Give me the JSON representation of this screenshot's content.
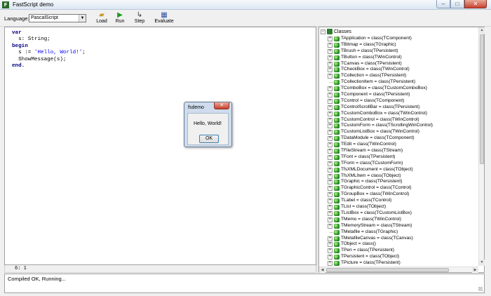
{
  "window": {
    "title": "FastScript demo",
    "icon": "fastscript-app-icon",
    "minimize": "–",
    "maximize": "□",
    "close": "✕"
  },
  "toolbar": {
    "language_label": "Language:",
    "language_value": "PascalScript",
    "buttons": [
      {
        "label": "Load",
        "icon": "folder-open-icon",
        "glyph": "📂"
      },
      {
        "label": "Run",
        "icon": "run-arrow-icon",
        "glyph": "▶"
      },
      {
        "label": "Step",
        "icon": "step-icon",
        "glyph": "↳"
      },
      {
        "label": "Evaluate",
        "icon": "evaluate-icon",
        "glyph": "▦"
      }
    ]
  },
  "editor": {
    "lines": [
      [
        {
          "t": "var",
          "c": "kw"
        }
      ],
      [
        {
          "t": "  s: ",
          "c": "plain"
        },
        {
          "t": "String",
          "c": "plain"
        },
        {
          "t": ";",
          "c": "plain"
        }
      ],
      [
        {
          "t": "begin",
          "c": "kw"
        }
      ],
      [
        {
          "t": "  s := ",
          "c": "plain"
        },
        {
          "t": "'Hello, World!'",
          "c": "str"
        },
        {
          "t": ";",
          "c": "plain"
        }
      ],
      [
        {
          "t": "  ShowMessage(s);",
          "c": "plain"
        }
      ],
      [
        {
          "t": "end.",
          "c": "kw"
        }
      ]
    ],
    "cursor_position": "6: 1"
  },
  "tree": {
    "root_label": "Classes",
    "items": [
      {
        "text": "TApplication = class(TComponent)",
        "expandable": true
      },
      {
        "text": "TBitmap = class(TGraphic)",
        "expandable": true
      },
      {
        "text": "TBrush = class(TPersistent)",
        "expandable": true
      },
      {
        "text": "TButton = class(TWinControl)",
        "expandable": true
      },
      {
        "text": "TCanvas = class(TPersistent)",
        "expandable": true
      },
      {
        "text": "TCheckBox = class(TWinControl)",
        "expandable": true
      },
      {
        "text": "TCollection = class(TPersistent)",
        "expandable": true
      },
      {
        "text": "TCollectionItem = class(TPersistent)",
        "expandable": false
      },
      {
        "text": "TComboBox = class(TCustomComboBox)",
        "expandable": true
      },
      {
        "text": "TComponent = class(TPersistent)",
        "expandable": true
      },
      {
        "text": "TControl = class(TComponent)",
        "expandable": true
      },
      {
        "text": "TControlScrollBar = class(TPersistent)",
        "expandable": true
      },
      {
        "text": "TCustomComboBox = class(TWinControl)",
        "expandable": true
      },
      {
        "text": "TCustomControl = class(TWinControl)",
        "expandable": true
      },
      {
        "text": "TCustomForm = class(TScrollingWinControl)",
        "expandable": true
      },
      {
        "text": "TCustomListBox = class(TWinControl)",
        "expandable": true
      },
      {
        "text": "TDataModule = class(TComponent)",
        "expandable": true
      },
      {
        "text": "TEdit = class(TWinControl)",
        "expandable": true
      },
      {
        "text": "TFileStream = class(TStream)",
        "expandable": true
      },
      {
        "text": "TFont = class(TPersistent)",
        "expandable": true
      },
      {
        "text": "TForm = class(TCustomForm)",
        "expandable": true
      },
      {
        "text": "TfsXMLDocument = class(TObject)",
        "expandable": true
      },
      {
        "text": "TfsXMLItem = class(TObject)",
        "expandable": true
      },
      {
        "text": "TGraphic = class(TPersistent)",
        "expandable": true
      },
      {
        "text": "TGraphicControl = class(TControl)",
        "expandable": true
      },
      {
        "text": "TGroupBox = class(TWinControl)",
        "expandable": true
      },
      {
        "text": "TLabel = class(TControl)",
        "expandable": true
      },
      {
        "text": "TList = class(TObject)",
        "expandable": true
      },
      {
        "text": "TListBox = class(TCustomListBox)",
        "expandable": true
      },
      {
        "text": "TMemo = class(TWinControl)",
        "expandable": true
      },
      {
        "text": "TMemoryStream = class(TStream)",
        "expandable": true
      },
      {
        "text": "TMetafile = class(TGraphic)",
        "expandable": false
      },
      {
        "text": "TMetafileCanvas = class(TCanvas)",
        "expandable": true
      },
      {
        "text": "TObject = class()",
        "expandable": true
      },
      {
        "text": "TPen = class(TPersistent)",
        "expandable": true
      },
      {
        "text": "TPersistent = class(TObject)",
        "expandable": true
      },
      {
        "text": "TPicture = class(TPersistent)",
        "expandable": true
      }
    ]
  },
  "output": {
    "text": "Compiled OK, Running..."
  },
  "dialog": {
    "title": "fsdemo",
    "message": "Hello, World!",
    "ok_label": "OK",
    "close": "✕"
  }
}
